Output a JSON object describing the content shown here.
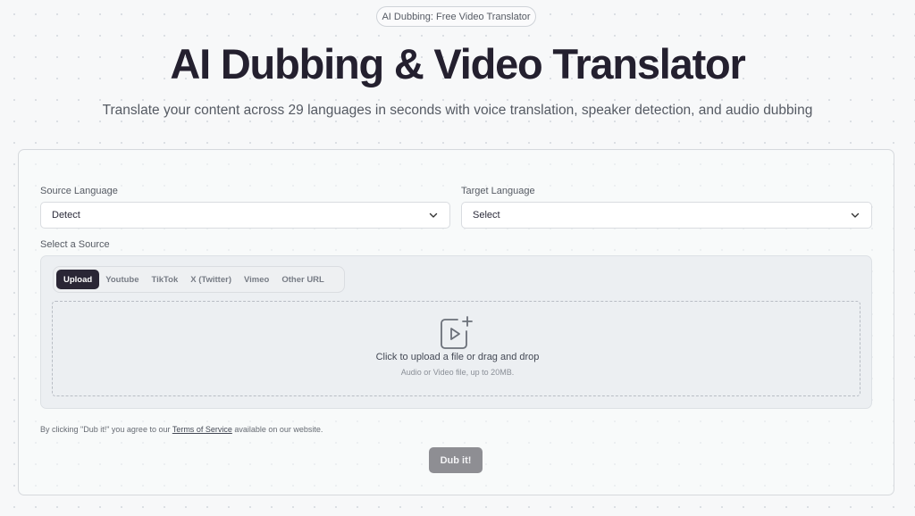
{
  "header": {
    "badge": "AI Dubbing: Free Video Translator",
    "title": "AI Dubbing & Video Translator",
    "subtitle": "Translate your content across 29 languages in seconds with voice translation, speaker detection, and audio dubbing"
  },
  "form": {
    "source_language": {
      "label": "Source Language",
      "value": "Detect"
    },
    "target_language": {
      "label": "Target Language",
      "value": "Select"
    },
    "source_label": "Select a Source",
    "tabs": [
      {
        "label": "Upload",
        "active": true
      },
      {
        "label": "Youtube",
        "active": false
      },
      {
        "label": "TikTok",
        "active": false
      },
      {
        "label": "X (Twitter)",
        "active": false
      },
      {
        "label": "Vimeo",
        "active": false
      },
      {
        "label": "Other URL",
        "active": false
      }
    ],
    "dropzone": {
      "icon": "video-upload-icon",
      "main_text": "Click to upload a file or drag and drop",
      "sub_text": "Audio or Video file, up to 20MB."
    },
    "terms": {
      "prefix": "By clicking \"Dub it!\" you agree to our",
      "link": "Terms of Service",
      "suffix": "available on our website."
    },
    "submit_label": "Dub it!"
  },
  "colors": {
    "active_tab": "#2a2635",
    "submit_disabled": "#8e8e93"
  }
}
